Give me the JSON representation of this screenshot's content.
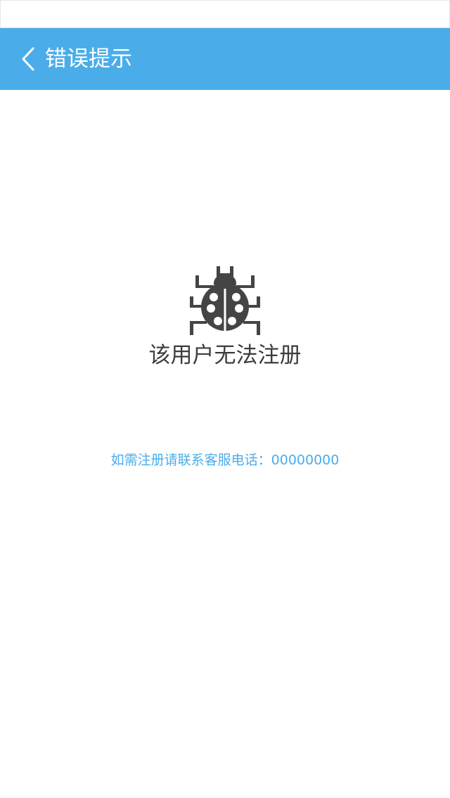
{
  "status_bar": {},
  "nav": {
    "back_icon": "chevron-left-icon",
    "title": "错误提示",
    "background_color": "#4aadea"
  },
  "error": {
    "icon": "bug-icon",
    "message": "该用户无法注册"
  },
  "contact": {
    "text": "如需注册请联系客服电话：00000000",
    "color": "#4aadea"
  }
}
